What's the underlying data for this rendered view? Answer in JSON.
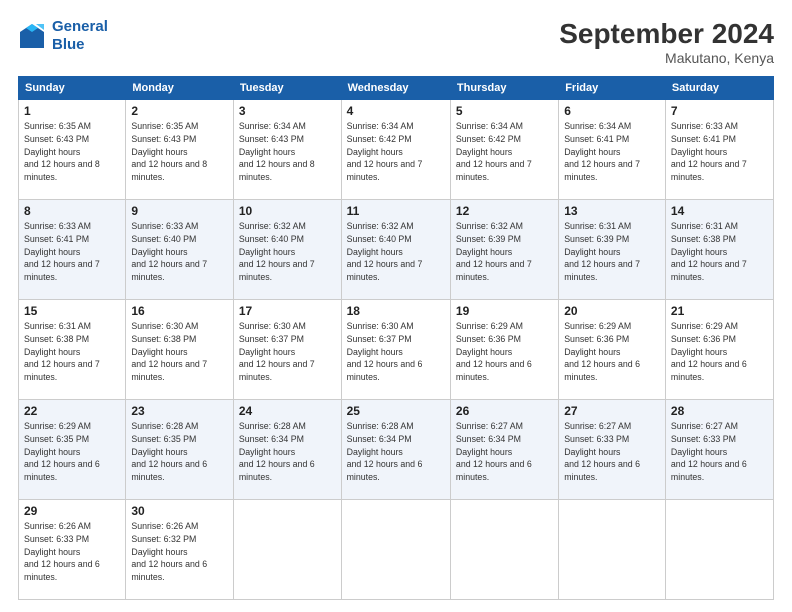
{
  "logo": {
    "line1": "General",
    "line2": "Blue"
  },
  "title": "September 2024",
  "location": "Makutano, Kenya",
  "days_of_week": [
    "Sunday",
    "Monday",
    "Tuesday",
    "Wednesday",
    "Thursday",
    "Friday",
    "Saturday"
  ],
  "weeks": [
    [
      {
        "day": "1",
        "rise": "6:35 AM",
        "set": "6:43 PM",
        "daylight": "12 hours and 8 minutes."
      },
      {
        "day": "2",
        "rise": "6:35 AM",
        "set": "6:43 PM",
        "daylight": "12 hours and 8 minutes."
      },
      {
        "day": "3",
        "rise": "6:34 AM",
        "set": "6:43 PM",
        "daylight": "12 hours and 8 minutes."
      },
      {
        "day": "4",
        "rise": "6:34 AM",
        "set": "6:42 PM",
        "daylight": "12 hours and 7 minutes."
      },
      {
        "day": "5",
        "rise": "6:34 AM",
        "set": "6:42 PM",
        "daylight": "12 hours and 7 minutes."
      },
      {
        "day": "6",
        "rise": "6:34 AM",
        "set": "6:41 PM",
        "daylight": "12 hours and 7 minutes."
      },
      {
        "day": "7",
        "rise": "6:33 AM",
        "set": "6:41 PM",
        "daylight": "12 hours and 7 minutes."
      }
    ],
    [
      {
        "day": "8",
        "rise": "6:33 AM",
        "set": "6:41 PM",
        "daylight": "12 hours and 7 minutes."
      },
      {
        "day": "9",
        "rise": "6:33 AM",
        "set": "6:40 PM",
        "daylight": "12 hours and 7 minutes."
      },
      {
        "day": "10",
        "rise": "6:32 AM",
        "set": "6:40 PM",
        "daylight": "12 hours and 7 minutes."
      },
      {
        "day": "11",
        "rise": "6:32 AM",
        "set": "6:40 PM",
        "daylight": "12 hours and 7 minutes."
      },
      {
        "day": "12",
        "rise": "6:32 AM",
        "set": "6:39 PM",
        "daylight": "12 hours and 7 minutes."
      },
      {
        "day": "13",
        "rise": "6:31 AM",
        "set": "6:39 PM",
        "daylight": "12 hours and 7 minutes."
      },
      {
        "day": "14",
        "rise": "6:31 AM",
        "set": "6:38 PM",
        "daylight": "12 hours and 7 minutes."
      }
    ],
    [
      {
        "day": "15",
        "rise": "6:31 AM",
        "set": "6:38 PM",
        "daylight": "12 hours and 7 minutes."
      },
      {
        "day": "16",
        "rise": "6:30 AM",
        "set": "6:38 PM",
        "daylight": "12 hours and 7 minutes."
      },
      {
        "day": "17",
        "rise": "6:30 AM",
        "set": "6:37 PM",
        "daylight": "12 hours and 7 minutes."
      },
      {
        "day": "18",
        "rise": "6:30 AM",
        "set": "6:37 PM",
        "daylight": "12 hours and 6 minutes."
      },
      {
        "day": "19",
        "rise": "6:29 AM",
        "set": "6:36 PM",
        "daylight": "12 hours and 6 minutes."
      },
      {
        "day": "20",
        "rise": "6:29 AM",
        "set": "6:36 PM",
        "daylight": "12 hours and 6 minutes."
      },
      {
        "day": "21",
        "rise": "6:29 AM",
        "set": "6:36 PM",
        "daylight": "12 hours and 6 minutes."
      }
    ],
    [
      {
        "day": "22",
        "rise": "6:29 AM",
        "set": "6:35 PM",
        "daylight": "12 hours and 6 minutes."
      },
      {
        "day": "23",
        "rise": "6:28 AM",
        "set": "6:35 PM",
        "daylight": "12 hours and 6 minutes."
      },
      {
        "day": "24",
        "rise": "6:28 AM",
        "set": "6:34 PM",
        "daylight": "12 hours and 6 minutes."
      },
      {
        "day": "25",
        "rise": "6:28 AM",
        "set": "6:34 PM",
        "daylight": "12 hours and 6 minutes."
      },
      {
        "day": "26",
        "rise": "6:27 AM",
        "set": "6:34 PM",
        "daylight": "12 hours and 6 minutes."
      },
      {
        "day": "27",
        "rise": "6:27 AM",
        "set": "6:33 PM",
        "daylight": "12 hours and 6 minutes."
      },
      {
        "day": "28",
        "rise": "6:27 AM",
        "set": "6:33 PM",
        "daylight": "12 hours and 6 minutes."
      }
    ],
    [
      {
        "day": "29",
        "rise": "6:26 AM",
        "set": "6:33 PM",
        "daylight": "12 hours and 6 minutes."
      },
      {
        "day": "30",
        "rise": "6:26 AM",
        "set": "6:32 PM",
        "daylight": "12 hours and 6 minutes."
      },
      null,
      null,
      null,
      null,
      null
    ]
  ]
}
